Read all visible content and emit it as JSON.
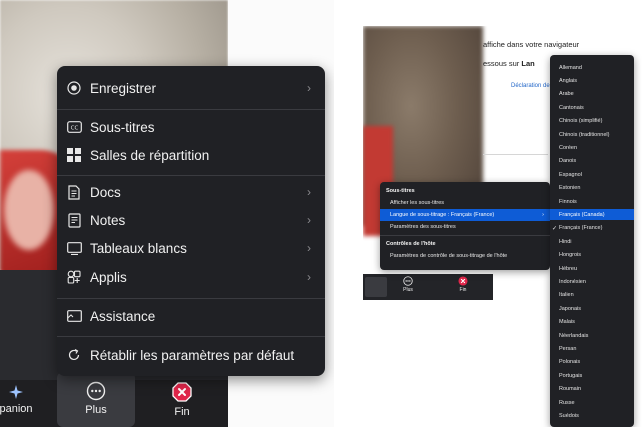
{
  "left_menu": {
    "items": [
      {
        "label": "Enregistrer",
        "icon": "record-icon",
        "chevron": true
      },
      {
        "label": "Sous-titres",
        "icon": "captions-icon",
        "chevron": false
      },
      {
        "label": "Salles de répartition",
        "icon": "breakout-rooms-icon",
        "chevron": false
      },
      {
        "label": "Docs",
        "icon": "docs-icon",
        "chevron": true
      },
      {
        "label": "Notes",
        "icon": "notes-icon",
        "chevron": true
      },
      {
        "label": "Tableaux blancs",
        "icon": "whiteboard-icon",
        "chevron": true
      },
      {
        "label": "Applis",
        "icon": "apps-icon",
        "chevron": true
      },
      {
        "label": "Assistance",
        "icon": "assistance-icon",
        "chevron": false
      },
      {
        "label": "Rétablir les paramètres par défaut",
        "icon": "reset-icon",
        "chevron": false
      }
    ]
  },
  "left_toolbar": {
    "companion_label": "panion",
    "more_label": "Plus",
    "end_label": "Fin"
  },
  "right_doc": {
    "line1": "affiche dans votre navigateur",
    "line2_prefix": "essous sur ",
    "line2_bold": "Lan",
    "line3_link": "Déclaration de"
  },
  "right_submenu": {
    "captions_header": "Sous-titres",
    "show_captions": "Afficher les sous-titres",
    "caption_language": "Langue de sous-titrage : Français (France)",
    "caption_settings": "Paramètres des sous-titres",
    "host_controls_header": "Contrôles de l'hôte",
    "host_settings": "Paramètres de contrôle de sous-titrage de l'hôte"
  },
  "right_toolbar": {
    "more_label": "Plus",
    "end_label": "Fin"
  },
  "languages": [
    {
      "label": "Allemand",
      "selected": false,
      "highlighted": false
    },
    {
      "label": "Anglais",
      "selected": false,
      "highlighted": false
    },
    {
      "label": "Arabe",
      "selected": false,
      "highlighted": false
    },
    {
      "label": "Cantonais",
      "selected": false,
      "highlighted": false
    },
    {
      "label": "Chinois (simplifié)",
      "selected": false,
      "highlighted": false
    },
    {
      "label": "Chinois (traditionnel)",
      "selected": false,
      "highlighted": false
    },
    {
      "label": "Coréen",
      "selected": false,
      "highlighted": false
    },
    {
      "label": "Danois",
      "selected": false,
      "highlighted": false
    },
    {
      "label": "Espagnol",
      "selected": false,
      "highlighted": false
    },
    {
      "label": "Estonien",
      "selected": false,
      "highlighted": false
    },
    {
      "label": "Finnois",
      "selected": false,
      "highlighted": false
    },
    {
      "label": "Français (Canada)",
      "selected": false,
      "highlighted": true
    },
    {
      "label": "Français (France)",
      "selected": true,
      "highlighted": false
    },
    {
      "label": "Hindi",
      "selected": false,
      "highlighted": false
    },
    {
      "label": "Hongrois",
      "selected": false,
      "highlighted": false
    },
    {
      "label": "Hébreu",
      "selected": false,
      "highlighted": false
    },
    {
      "label": "Indonésien",
      "selected": false,
      "highlighted": false
    },
    {
      "label": "Italien",
      "selected": false,
      "highlighted": false
    },
    {
      "label": "Japonais",
      "selected": false,
      "highlighted": false
    },
    {
      "label": "Malais",
      "selected": false,
      "highlighted": false
    },
    {
      "label": "Néerlandais",
      "selected": false,
      "highlighted": false
    },
    {
      "label": "Persan",
      "selected": false,
      "highlighted": false
    },
    {
      "label": "Polonais",
      "selected": false,
      "highlighted": false
    },
    {
      "label": "Portugais",
      "selected": false,
      "highlighted": false
    },
    {
      "label": "Roumain",
      "selected": false,
      "highlighted": false
    },
    {
      "label": "Russe",
      "selected": false,
      "highlighted": false
    },
    {
      "label": "Suédois",
      "selected": false,
      "highlighted": false
    }
  ],
  "colors": {
    "menu_bg": "#202125",
    "highlight": "#0e5cd6",
    "end_icon": "#e0264a"
  }
}
